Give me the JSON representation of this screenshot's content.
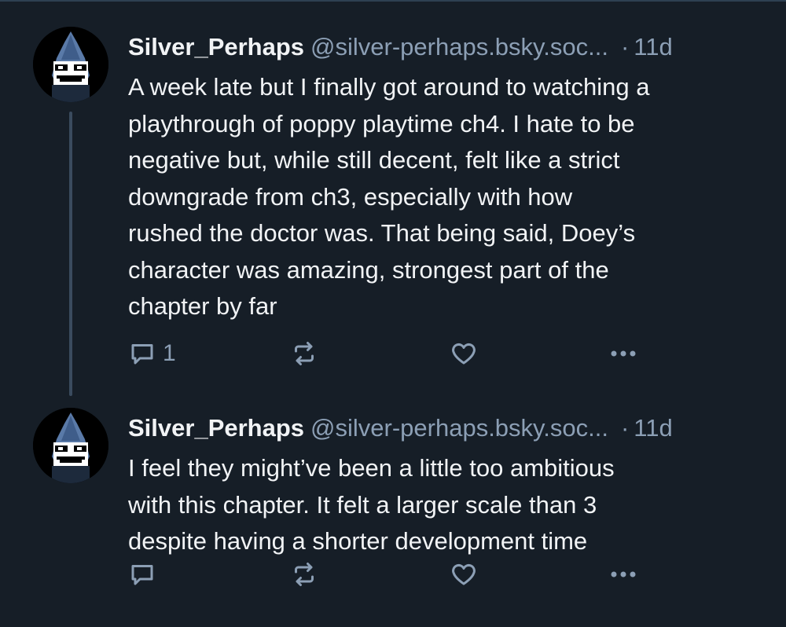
{
  "posts": [
    {
      "display_name": "Silver_Perhaps",
      "handle": "@silver-perhaps.bsky.soc...",
      "separator": "·",
      "timestamp": "11d",
      "text": "A week late but I finally got around to watching a\nplaythrough of poppy playtime ch4. I hate to be\nnegative but, while still decent, felt like a strict\ndowngrade from ch3, especially with how\nrushed the doctor was. That being said, Doey’s\ncharacter was amazing, strongest part of the\nchapter by far",
      "reply_count": "1",
      "avatar_icon": "pixel-character-avatar",
      "actions": [
        "reply-icon",
        "repost-icon",
        "like-icon",
        "more-icon"
      ]
    },
    {
      "display_name": "Silver_Perhaps",
      "handle": "@silver-perhaps.bsky.soc...",
      "separator": "·",
      "timestamp": "11d",
      "text": "I feel they might’ve been a little too ambitious\nwith this chapter. It felt a larger scale than 3\ndespite having a shorter development time",
      "reply_count": "",
      "avatar_icon": "pixel-character-avatar",
      "actions": [
        "reply-icon",
        "repost-icon",
        "like-icon",
        "more-icon"
      ]
    }
  ],
  "colors": {
    "background": "#161e27",
    "text": "#f1f3f5",
    "muted": "#8c9fb5",
    "thread_line": "#3a4b5e"
  }
}
